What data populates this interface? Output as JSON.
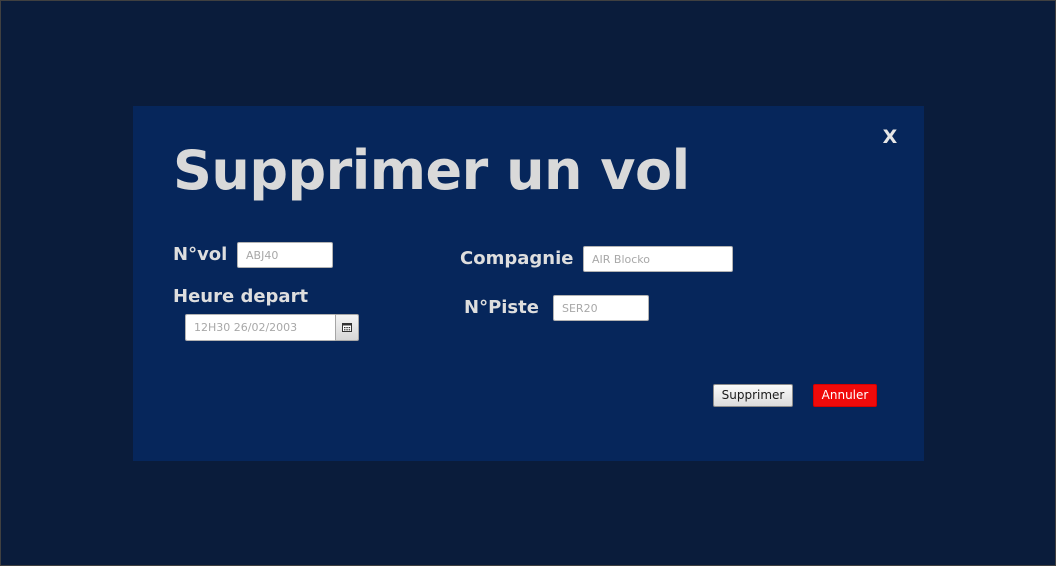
{
  "dialog": {
    "title": "Supprimer un vol",
    "close_label": "X"
  },
  "form": {
    "flight_number": {
      "label": "N°vol",
      "placeholder": "ABJ40"
    },
    "departure_time": {
      "label": "Heure depart",
      "placeholder": "12H30 26/02/2003",
      "picker_icon": "calendar-icon"
    },
    "company": {
      "label": "Compagnie",
      "placeholder": "AIR Blocko"
    },
    "runway": {
      "label": "N°Piste",
      "placeholder": "SER20"
    }
  },
  "actions": {
    "delete_label": "Supprimer",
    "cancel_label": "Annuler"
  },
  "colors": {
    "window_background": "#0a1c3b",
    "dialog_background": "#06265b",
    "label_text": "#dedede",
    "cancel_button": "#f00a0a"
  }
}
